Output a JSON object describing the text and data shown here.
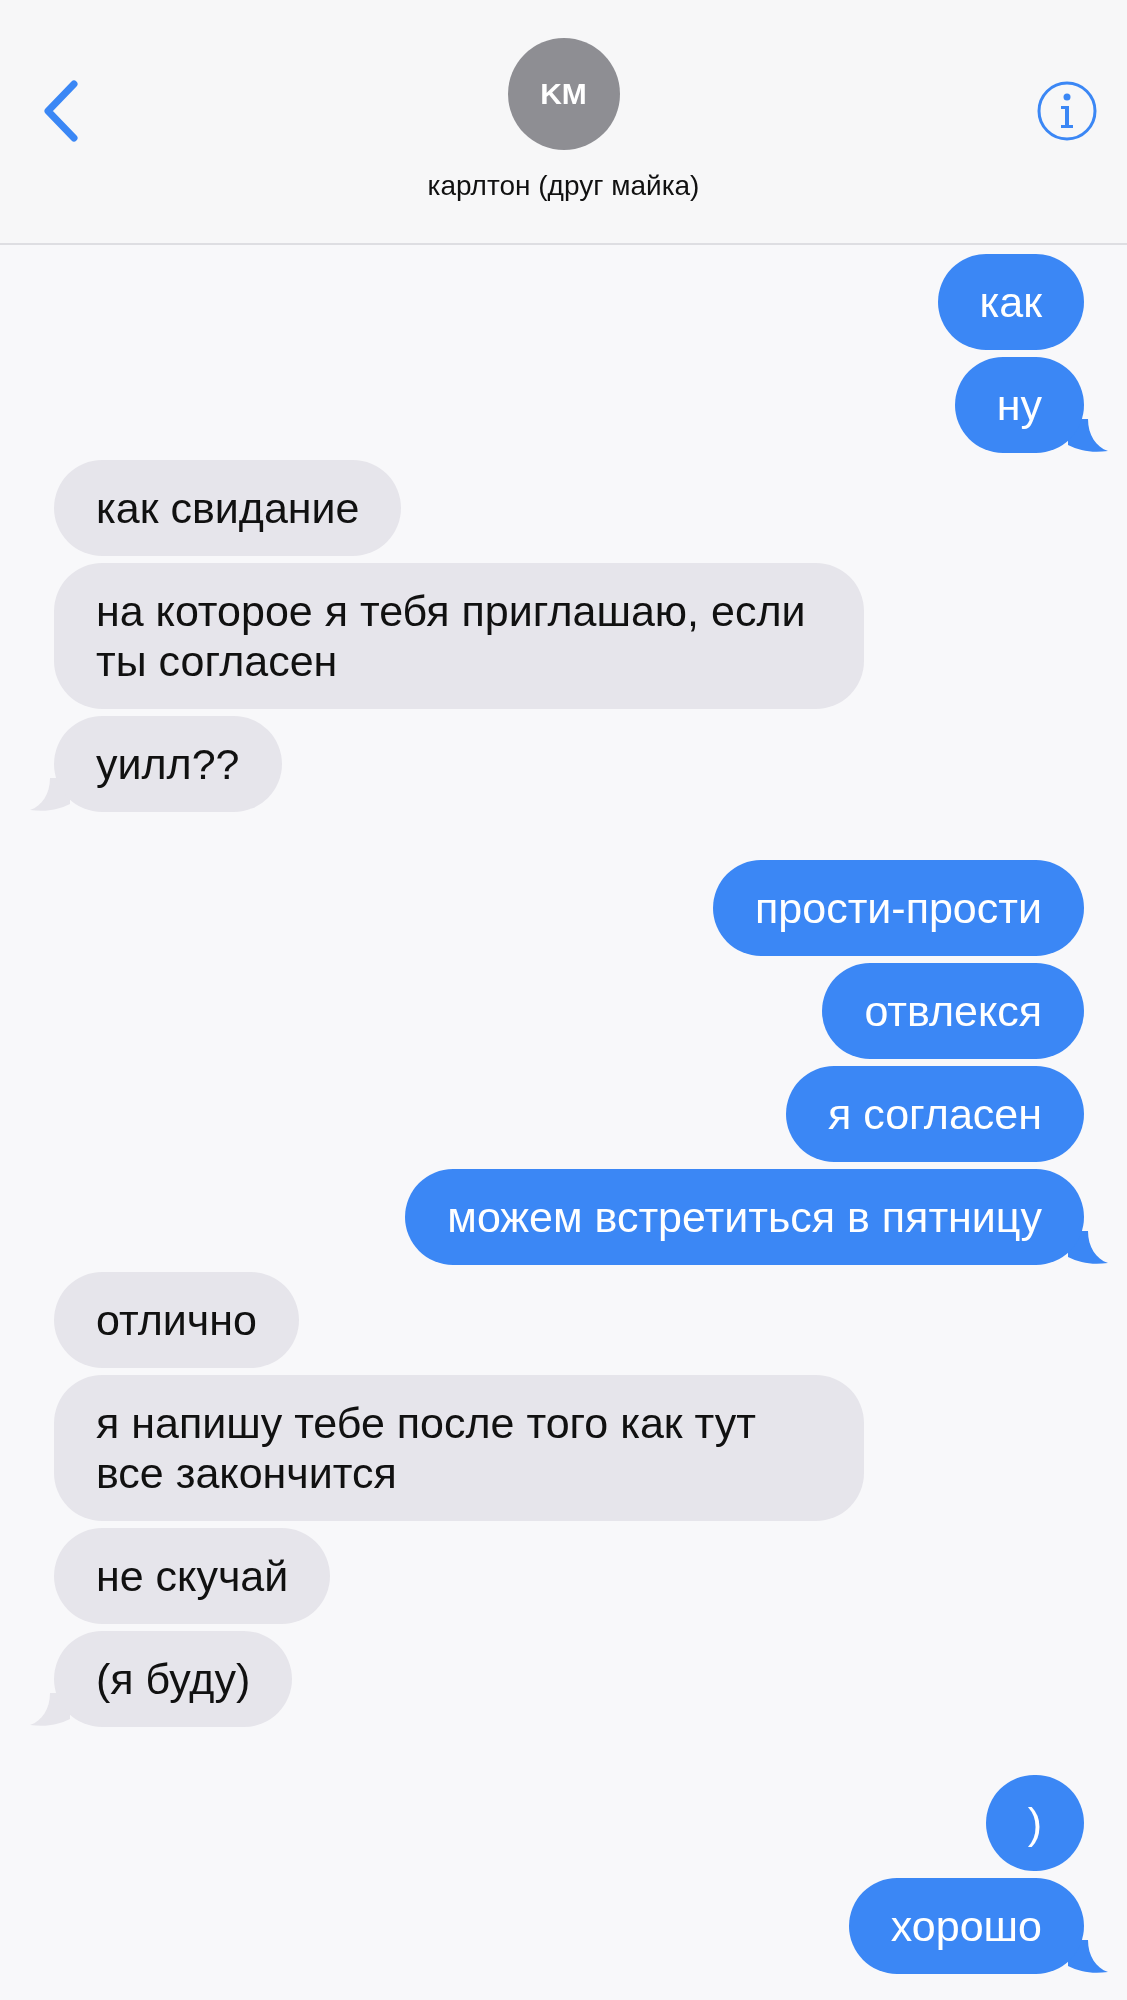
{
  "header": {
    "avatar_initials": "KM",
    "contact_name": "карлтон (друг майка)"
  },
  "groups": [
    {
      "kind": "outgoing",
      "gap": false,
      "messages": [
        "как",
        "ну"
      ]
    },
    {
      "kind": "incoming",
      "gap": false,
      "messages": [
        "как свидание",
        "на которое я тебя приглашаю, если ты согласен",
        "уилл??"
      ]
    },
    {
      "kind": "outgoing",
      "gap": true,
      "messages": [
        "прости-прости",
        "отвлекся",
        "я согласен",
        "можем встретиться в пятницу"
      ]
    },
    {
      "kind": "incoming",
      "gap": false,
      "messages": [
        "отлично",
        "я напишу тебе после того как тут все закончится",
        "не скучай",
        "(я буду)"
      ]
    },
    {
      "kind": "outgoing",
      "gap": true,
      "messages": [
        ")",
        "хорошо"
      ]
    }
  ]
}
